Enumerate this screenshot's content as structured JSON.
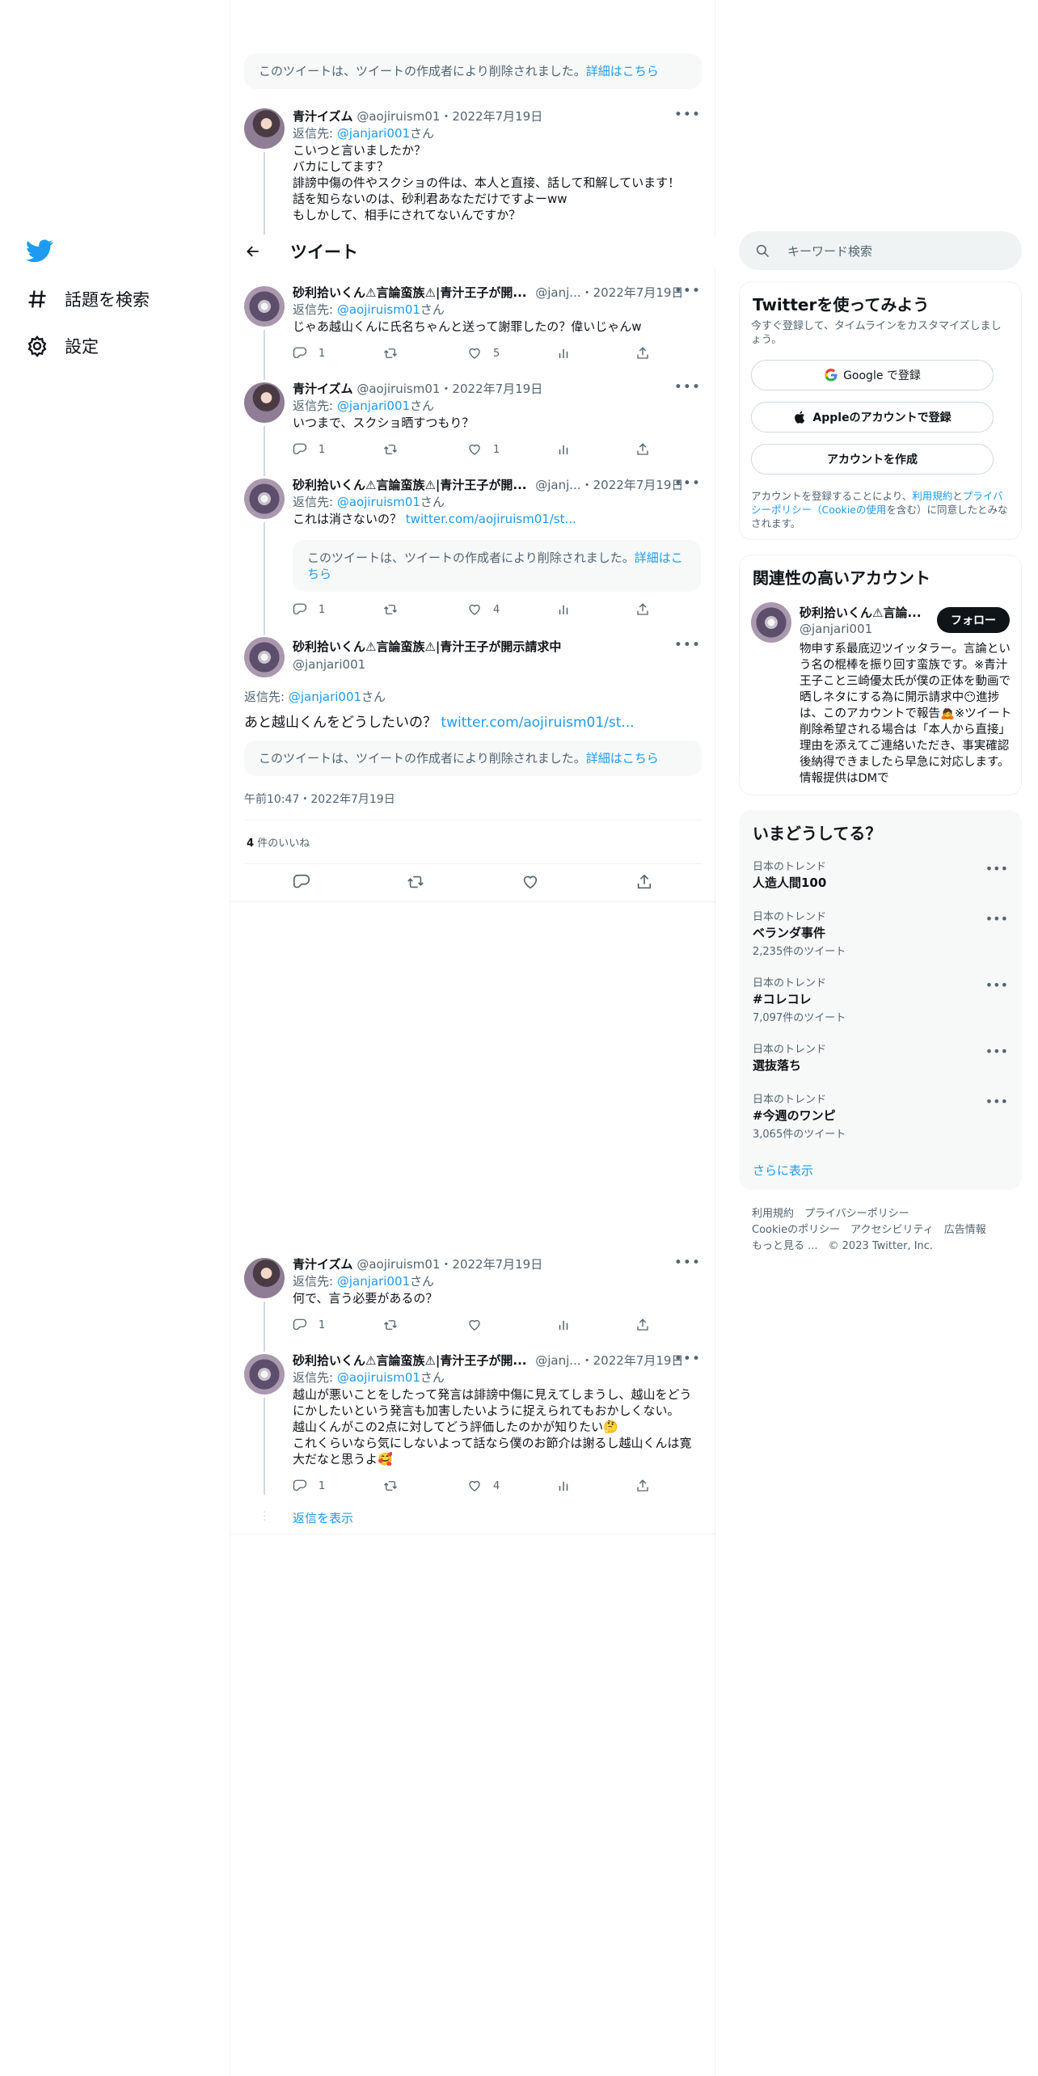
{
  "nav": {
    "explore_label": "話題を検索",
    "settings_label": "設定"
  },
  "header": {
    "title": "ツイート"
  },
  "deleted_notice": {
    "text": "このツイートは、ツイートの作成者により削除されました。",
    "more": "詳細はこちら"
  },
  "tweets": [
    {
      "name": "青汁イズム",
      "handle": "@aojiruism01",
      "date": "2022年7月19日",
      "reply_label": "返信先:",
      "reply_to": "@janjari001",
      "reply_suffix": "さん",
      "text": "こいつと言いましたか？\nバカにしてます？\n誹謗中傷の件やスクショの件は、本人と直接、話して和解しています！\n話を知らないのは、砂利君あなただけですよーww\nもしかして、相手にされてないんですか？"
    },
    {
      "name": "砂利拾いくん⚠言論蛮族⚠|青汁王子が開...",
      "handle": "@janj...",
      "date": "2022年7月19日",
      "reply_label": "返信先:",
      "reply_to": "@aojiruism01",
      "reply_suffix": "さん",
      "text": "じゃあ越山くんに氏名ちゃんと送って謝罪したの？偉いじゃんw",
      "replies": "1",
      "likes": "5"
    },
    {
      "name": "青汁イズム",
      "handle": "@aojiruism01",
      "date": "2022年7月19日",
      "reply_label": "返信先:",
      "reply_to": "@janjari001",
      "reply_suffix": "さん",
      "text": "いつまで、スクショ晒すつもり？",
      "replies": "1",
      "likes": "1"
    },
    {
      "name": "砂利拾いくん⚠言論蛮族⚠|青汁王子が開...",
      "handle": "@janj...",
      "date": "2022年7月19日",
      "reply_label": "返信先:",
      "reply_to": "@aojiruism01",
      "reply_suffix": "さん",
      "text": "これは消さないの？",
      "link": "twitter.com/aojiruism01/st...",
      "quote_text": "このツイートは、ツイートの作成者により削除されました。",
      "quote_more": "詳細はこちら",
      "replies": "1",
      "likes": "4"
    }
  ],
  "focus": {
    "name": "砂利拾いくん⚠言論蛮族⚠|青汁王子が開示請求中",
    "handle": "@janjari001",
    "reply_label": "返信先:",
    "reply_to": "@janjari001",
    "reply_suffix": "さん",
    "text": "あと越山くんをどうしたいの？",
    "link": "twitter.com/aojiruism01/st...",
    "quote_text": "このツイートは、ツイートの作成者により削除されました。",
    "quote_more": "詳細はこちら",
    "time": "午前10:47・2022年7月19日",
    "like_count": "4",
    "like_label": "件のいいね"
  },
  "replies": [
    {
      "name": "青汁イズム",
      "handle": "@aojiruism01",
      "date": "2022年7月19日",
      "reply_label": "返信先:",
      "reply_to": "@janjari001",
      "reply_suffix": "さん",
      "text": "何で、言う必要があるの？",
      "replies": "1"
    },
    {
      "name": "砂利拾いくん⚠言論蛮族⚠|青汁王子が開...",
      "handle": "@janj...",
      "date": "2022年7月19日",
      "reply_label": "返信先:",
      "reply_to": "@aojiruism01",
      "reply_suffix": "さん",
      "text": "越山が悪いことをしたって発言は誹謗中傷に見えてしまうし、越山をどうにかしたいという発言も加害したいように捉えられてもおかしくない。\n越山くんがこの2点に対してどう評価したのかが知りたい🤔\nこれくらいなら気にしないよって話なら僕のお節介は謝るし越山くんは寛大だなと思うよ🥰",
      "replies": "1",
      "likes": "4"
    }
  ],
  "show_replies": "返信を表示",
  "right": {
    "search_placeholder": "キーワード検索",
    "signup": {
      "title": "Twitterを使ってみよう",
      "subtitle": "今すぐ登録して、タイムラインをカスタマイズしましょう。",
      "google": "Google で登録",
      "apple": "Appleのアカウントで登録",
      "create": "アカウントを作成",
      "terms_pre": "アカウントを登録することにより、",
      "terms_link1": "利用規約",
      "terms_mid": "と",
      "terms_link2": "プライバシーポリシー（Cookieの使用",
      "terms_post": "を含む）に同意したとみなされます。"
    },
    "related": {
      "title": "関連性の高いアカウント",
      "name": "砂利拾いくん⚠言論...",
      "handle": "@janjari001",
      "follow": "フォロー",
      "bio": "物申す系最底辺ツイッタラー。言論という名の棍棒を振り回す蛮族です。※青汁王子こと三崎優太氏が僕の正体を動画で晒しネタにする為に開示請求中😶進捗は、このアカウントで報告🙇※ツイート削除希望される場合は「本人から直接」理由を添えてご連絡いただき、事実確認後納得できましたら早急に対応します。情報提供はDMで"
    },
    "trends": {
      "title": "いまどうしてる？",
      "items": [
        {
          "loc": "日本のトレンド",
          "name": "人造人間100",
          "count": ""
        },
        {
          "loc": "日本のトレンド",
          "name": "ベランダ事件",
          "count": "2,235件のツイート"
        },
        {
          "loc": "日本のトレンド",
          "name": "#コレコレ",
          "count": "7,097件のツイート"
        },
        {
          "loc": "日本のトレンド",
          "name": "選抜落ち",
          "count": ""
        },
        {
          "loc": "日本のトレンド",
          "name": "#今週のワンピ",
          "count": "3,065件のツイート"
        }
      ],
      "more": "さらに表示"
    },
    "footer": {
      "line1": "利用規約　プライバシーポリシー",
      "line2": "Cookieのポリシー　アクセシビリティ　広告情報",
      "line3": "もっと見る ...　© 2023 Twitter, Inc."
    }
  }
}
